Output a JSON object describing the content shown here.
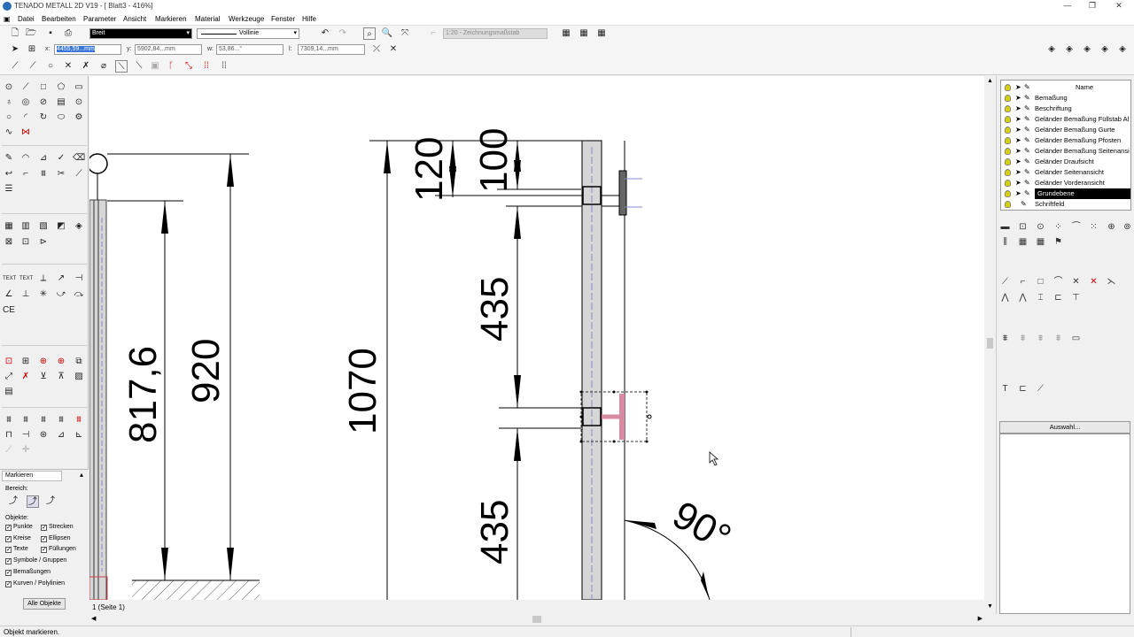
{
  "window": {
    "title": "TENADO METALL 2D V19 - [ Blatt3 - 416%]"
  },
  "menu": [
    "Datei",
    "Bearbeiten",
    "Parameter",
    "Ansicht",
    "Markieren",
    "Material",
    "Werkzeuge",
    "Fenster",
    "Hilfe"
  ],
  "toolbar": {
    "pen_width": "Breit",
    "line_type": "Vollinie",
    "scale": "1:20 - Zeichnungsmaßstab"
  },
  "coords": {
    "x_label": "x:",
    "x_value": "4455,59...mm",
    "y_label": "y:",
    "y_value": "5902,84...mm",
    "w_label": "w:",
    "w_value": "53,86...°",
    "l_label": "l:",
    "l_value": "7309,14...mm"
  },
  "drawing": {
    "dims": [
      "817,6",
      "920",
      "1070",
      "120",
      "100",
      "435",
      "435",
      "90°"
    ]
  },
  "layers": {
    "header": "Name",
    "items": [
      "Bemaßung",
      "Beschriftung",
      "Geländer Bemaßung Füllstab Al",
      "Geländer Bemaßung Gurte",
      "Geländer Bemaßung Pfosten",
      "Geländer Bemaßung Seitenansi",
      "Geländer Draufsicht",
      "Geländer Seitenansicht",
      "Geländer Vorderansicht",
      "Grundebene",
      "Schriftfeld"
    ],
    "selected": "Grundebene"
  },
  "auswahl_button": "Auswahl...",
  "markieren": {
    "tab": "Markieren",
    "bereich": "Bereich:",
    "objekte": "Objekte:",
    "checks": [
      "Punkte",
      "Strecken",
      "Kreise",
      "Ellipsen",
      "Texte",
      "Füllungen",
      "Symbole / Gruppen",
      "Bemaßungen",
      "Kurven / Polylinien"
    ],
    "all_button": "Alle Objekte"
  },
  "page_tab": "1 (Seite 1)",
  "status": "Objekt markieren."
}
